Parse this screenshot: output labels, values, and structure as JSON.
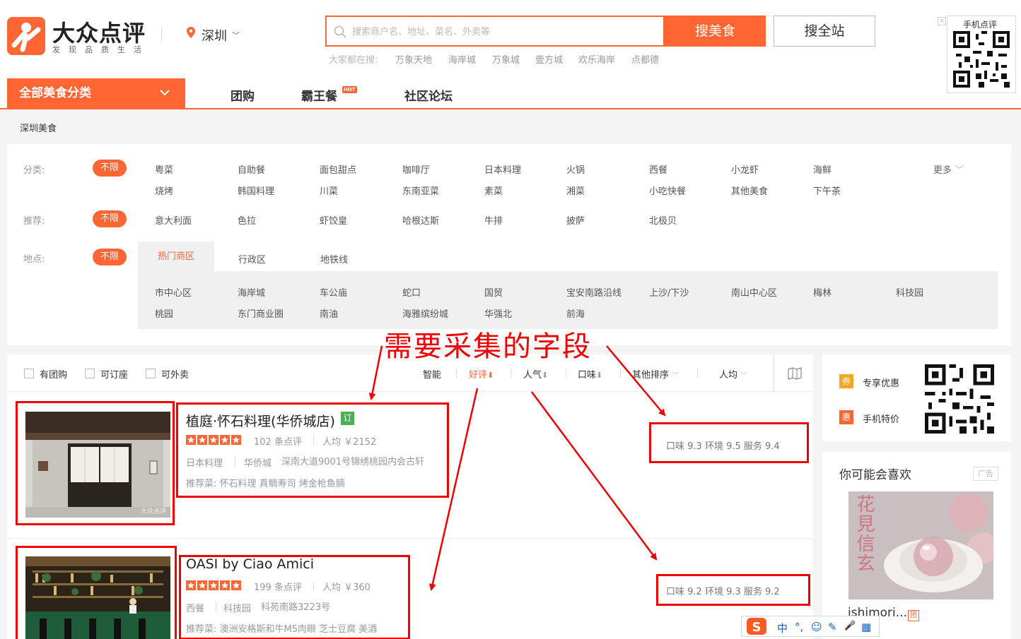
{
  "brand": {
    "name": "大众点评",
    "slogan": "发现品质生活"
  },
  "city": "深圳",
  "search": {
    "placeholder": "搜索商户名、地址、菜名、外卖等",
    "food_button": "搜美食",
    "all_button": "搜全站",
    "hot_label": "大家都在搜:",
    "hot_words": [
      "万象天地",
      "海岸城",
      "万象城",
      "壹方城",
      "欢乐海岸",
      "点都德"
    ]
  },
  "mobile_qr": {
    "title": "手机点评",
    "close": "×"
  },
  "nav": {
    "category": "全部美食分类",
    "items": [
      "团购",
      "霸王餐",
      "社区论坛"
    ],
    "hot_badge": "HOT"
  },
  "breadcrumb": "深圳美食",
  "filters": {
    "unlimited": "不限",
    "more": "更多",
    "category": {
      "label": "分类:",
      "row1": [
        "粤菜",
        "自助餐",
        "面包甜点",
        "咖啡厅",
        "日本料理",
        "火锅",
        "西餐",
        "小龙虾",
        "海鲜"
      ],
      "row2": [
        "烧烤",
        "韩国料理",
        "川菜",
        "东南亚菜",
        "素菜",
        "湘菜",
        "小吃快餐",
        "其他美食",
        "下午茶"
      ]
    },
    "recommend": {
      "label": "推荐:",
      "items": [
        "意大利面",
        "色拉",
        "虾饺皇",
        "哈根达斯",
        "牛排",
        "披萨",
        "北极贝"
      ]
    },
    "location": {
      "label": "地点:",
      "tabs": [
        "热门商区",
        "行政区",
        "地铁线"
      ],
      "row1": [
        "市中心区",
        "海岸城",
        "车公庙",
        "蛇口",
        "国贸",
        "宝安南路沿线",
        "上沙/下沙",
        "南山中心区",
        "梅林",
        "科技园"
      ],
      "row2": [
        "桃园",
        "东门商业圈",
        "南油",
        "海雅缤纷城",
        "华强北",
        "前海"
      ]
    }
  },
  "sort": {
    "checkboxes": [
      "有团购",
      "可订座",
      "可外卖"
    ],
    "options": [
      "智能",
      "好评",
      "人气",
      "口味",
      "其他排序",
      "人均"
    ]
  },
  "annotation": "需要采集的字段",
  "shops": [
    {
      "name": "植庭·怀石料理(华侨城店)",
      "badge": "订",
      "rating_stars": 5,
      "reviews": "102 条点评",
      "avg_price": "人均 ￥2152",
      "cuisine": "日本料理",
      "area": "华侨城",
      "address": "深南大道9001号锦绣桃园内会古轩",
      "recommend": "推荐菜:  怀石料理  真鲷寿司  烤金枪鱼腩",
      "scores": "口味 9.3    环境 9.5    服务 9.4",
      "watermark": "大众点评"
    },
    {
      "name": "OASI by Ciao Amici",
      "rating_stars": 5,
      "reviews": "199 条点评",
      "avg_price": "人均 ￥360",
      "cuisine": "西餐",
      "area": "科技园",
      "address": "科苑南路3223号",
      "recommend": "推荐菜:  澳洲安格斯和牛M5肉眼  芝士豆腐  美酒",
      "scores": "口味 9.2    环境 9.3    服务 9.2"
    }
  ],
  "sidebar": {
    "promos": [
      {
        "badge": "券",
        "text": "专享优惠",
        "color": "#f5a623"
      },
      {
        "badge": "惠",
        "text": "手机特价",
        "color": "#ff6633"
      }
    ],
    "reco_title": "你可能会喜欢",
    "ad_label": "广告",
    "reco_name": "ishimori...",
    "reco_badge": "团",
    "reco_img_text": "花見信玄"
  },
  "ime": {
    "glyphs": [
      "中",
      "°,",
      "☺",
      "✎",
      "🎤",
      "▦"
    ]
  },
  "colors": {
    "accent": "#ff6633",
    "annotation": "#e00000",
    "order_badge": "#4caf50"
  }
}
